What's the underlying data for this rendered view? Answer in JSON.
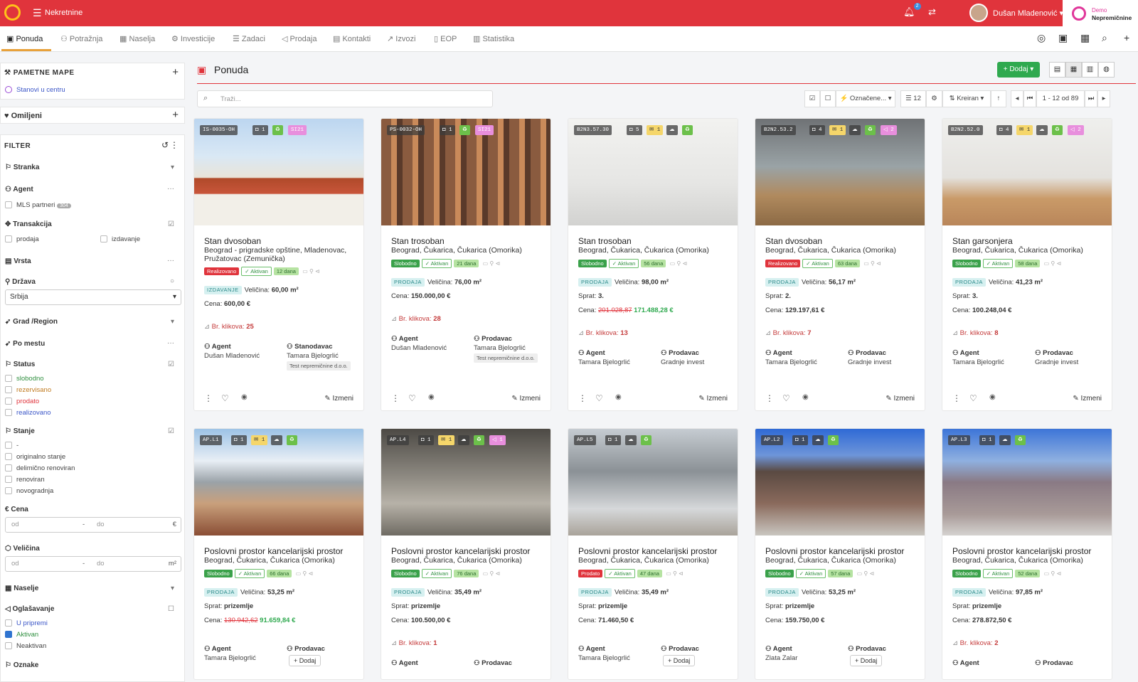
{
  "topbar": {
    "app_title": "Nekretnine",
    "notif_count": "2",
    "user_name": "Dušan Mladenović",
    "demo_line1": "Demo",
    "demo_line2": "Nepremičnine"
  },
  "nav": {
    "items": [
      "Ponuda",
      "Potražnja",
      "Naselja",
      "Investicije",
      "Zadaci",
      "Prodaja",
      "Kontakti",
      "Izvozi",
      "EOP",
      "Statistika"
    ]
  },
  "sidebar": {
    "smart_maps_title": "PAMETNE MAPE",
    "smart_map_item": "Stanovi u centru",
    "favorites_title": "Omiljeni",
    "filter_title": "FILTER",
    "stranka": "Stranka",
    "agent": "Agent",
    "mls": "MLS partneri",
    "mls_count": "304",
    "transakcija": "Transakcija",
    "prodaja": "prodaja",
    "izdavanje": "izdavanje",
    "vrsta": "Vrsta",
    "drzava": "Država",
    "drzava_value": "Srbija",
    "grad": "Grad /Region",
    "po_mestu": "Po mestu",
    "status": "Status",
    "status_opts": [
      "slobodno",
      "rezervisano",
      "prodato",
      "realizovano"
    ],
    "stanje": "Stanje",
    "stanje_opts": [
      "-",
      "originalno stanje",
      "delimično renoviran",
      "renoviran",
      "novogradnja"
    ],
    "cena": "Cena",
    "cena_from": "od",
    "cena_to": "do",
    "cena_unit": "€",
    "velicina": "Veličina",
    "vel_from": "od",
    "vel_to": "do",
    "vel_unit": "m²",
    "naselje": "Naselje",
    "oglasavanje": "Oglašavanje",
    "ogl_opts": [
      "U pripremi",
      "Aktivan",
      "Neaktivan"
    ],
    "oznake": "Oznake"
  },
  "main": {
    "title": "Ponuda",
    "dodaj": "+ Dodaj ▾",
    "search_placeholder": "Traži...",
    "oznacene": "⚡ Označene... ▾",
    "per_page": "☰ 12",
    "sort": "⇅ Kreiran ▾",
    "pagination": "1 - 12 od 89"
  },
  "labels": {
    "agent": "Agent",
    "prodavac": "Prodavac",
    "stanodavac": "Stanodavac",
    "izmeni": "Izmeni",
    "dodaj": "+ Dodaj",
    "aktivan": "✓ Aktivan",
    "size": "Veličina:",
    "floor": "Sprat:",
    "price": "Cena:",
    "clicks": "Br. klikova:"
  },
  "cards": [
    {
      "code": "IS-0035-OH",
      "photos": "1",
      "notes": "",
      "extra": "SI21",
      "title": "Stan dvosoban",
      "location": "Beograd - prigradske opštine, Mladenovac, Pružatovac (Zemunička)",
      "status": "Realizovano",
      "days": "12 dana",
      "trans": "IZDAVANJE",
      "size": "60,00 m²",
      "floor": "",
      "old_price": "",
      "price": "600,00 €",
      "clicks": "25",
      "agent": "Dušan Mladenović",
      "owner_label": "Stanodavac",
      "owner": "Tamara Bjelogrlić",
      "owner_note": "Test nepremičnine d.o.o."
    },
    {
      "code": "PS-0032-OH",
      "photos": "1",
      "notes": "",
      "extra": "SI21",
      "title": "Stan trosoban",
      "location": "Beograd, Čukarica, Čukarica (Omorika)",
      "status": "Slobodno",
      "days": "21 dana",
      "trans": "PRODAJA",
      "size": "76,00 m²",
      "floor": "",
      "old_price": "",
      "price": "150.000,00 €",
      "clicks": "28",
      "agent": "Dušan Mladenović",
      "owner_label": "Prodavac",
      "owner": "Tamara Bjelogrlić",
      "owner_note": "Test nepremičnine d.o.o."
    },
    {
      "code": "B2N3.57.30",
      "photos": "5",
      "notes": "1",
      "extra": "",
      "title": "Stan trosoban",
      "location": "Beograd, Čukarica, Čukarica (Omorika)",
      "status": "Slobodno",
      "days": "56 dana",
      "trans": "PRODAJA",
      "size": "98,00 m²",
      "floor": "3.",
      "old_price": "201.028,87",
      "price": "171.488,28 €",
      "clicks": "13",
      "agent": "Tamara Bjelogrlić",
      "owner_label": "Prodavac",
      "owner": "Gradnje invest",
      "owner_note": ""
    },
    {
      "code": "B2N2.53.2",
      "photos": "4",
      "notes": "1",
      "extra": "2",
      "title": "Stan dvosoban",
      "location": "Beograd, Čukarica, Čukarica (Omorika)",
      "status": "Realizovano",
      "days": "63 dana",
      "trans": "PRODAJA",
      "size": "56,17 m²",
      "floor": "2.",
      "old_price": "",
      "price": "129.197,61 €",
      "clicks": "7",
      "agent": "Tamara Bjelogrlić",
      "owner_label": "Prodavac",
      "owner": "Gradnje invest",
      "owner_note": ""
    },
    {
      "code": "B2N2.52.0",
      "photos": "4",
      "notes": "1",
      "extra": "2",
      "title": "Stan garsonjera",
      "location": "Beograd, Čukarica, Čukarica (Omorika)",
      "status": "Slobodno",
      "days": "58 dana",
      "trans": "PRODAJA",
      "size": "41,23 m²",
      "floor": "3.",
      "old_price": "",
      "price": "100.248,04 €",
      "clicks": "8",
      "agent": "Tamara Bjelogrlić",
      "owner_label": "Prodavac",
      "owner": "Gradnje invest",
      "owner_note": ""
    },
    {
      "code": "AP.L1",
      "photos": "1",
      "notes": "1",
      "extra": "",
      "title": "Poslovni prostor kancelarijski prostor",
      "location": "Beograd, Čukarica, Čukarica (Omorika)",
      "status": "Slobodno",
      "days": "66 dana",
      "trans": "PRODAJA",
      "size": "53,25 m²",
      "floor": "prizemlje",
      "old_price": "130.942,62",
      "price": "91.659,84 €",
      "clicks": "",
      "agent": "Tamara Bjelogrlić",
      "owner_label": "Prodavac",
      "owner": "",
      "owner_note": ""
    },
    {
      "code": "AP.L4",
      "photos": "1",
      "notes": "1",
      "extra": "1",
      "title": "Poslovni prostor kancelarijski prostor",
      "location": "Beograd, Čukarica, Čukarica (Omorika)",
      "status": "Slobodno",
      "days": "76 dana",
      "trans": "PRODAJA",
      "size": "35,49 m²",
      "floor": "prizemlje",
      "old_price": "",
      "price": "100.500,00 €",
      "clicks": "1",
      "agent": "",
      "owner_label": "Prodavac",
      "owner": "",
      "owner_note": ""
    },
    {
      "code": "AP.L5",
      "photos": "1",
      "notes": "",
      "extra": "",
      "title": "Poslovni prostor kancelarijski prostor",
      "location": "Beograd, Čukarica, Čukarica (Omorika)",
      "status": "Prodato",
      "days": "47 dana",
      "trans": "PRODAJA",
      "size": "35,49 m²",
      "floor": "prizemlje",
      "old_price": "",
      "price": "71.460,50 €",
      "clicks": "",
      "agent": "Tamara Bjelogrlić",
      "owner_label": "Prodavac",
      "owner": "",
      "owner_note": ""
    },
    {
      "code": "AP.L2",
      "photos": "1",
      "notes": "",
      "extra": "",
      "title": "Poslovni prostor kancelarijski prostor",
      "location": "Beograd, Čukarica, Čukarica (Omorika)",
      "status": "Slobodno",
      "days": "57 dana",
      "trans": "PRODAJA",
      "size": "53,25 m²",
      "floor": "prizemlje",
      "old_price": "",
      "price": "159.750,00 €",
      "clicks": "",
      "agent": "Zlata Zalar",
      "owner_label": "Prodavac",
      "owner": "",
      "owner_note": ""
    },
    {
      "code": "AP.L3",
      "photos": "1",
      "notes": "",
      "extra": "",
      "title": "Poslovni prostor kancelarijski prostor",
      "location": "Beograd, Čukarica, Čukarica (Omorika)",
      "status": "Slobodno",
      "days": "52 dana",
      "trans": "PRODAJA",
      "size": "97,85 m²",
      "floor": "prizemlje",
      "old_price": "",
      "price": "278.872,50 €",
      "clicks": "2",
      "agent": "",
      "owner_label": "Prodavac",
      "owner": "",
      "owner_note": ""
    }
  ],
  "colors": {
    "brand_red": "#e0343c",
    "green": "#2fa94f",
    "accent": "#e8a13a"
  }
}
